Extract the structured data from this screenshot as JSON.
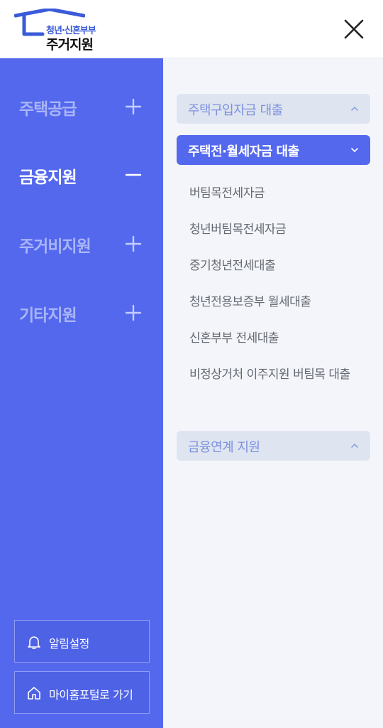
{
  "header": {
    "logo_line1": "청년·신혼부부",
    "logo_line2": "주거지원"
  },
  "sidebar": {
    "categories": [
      {
        "label": "주택공급",
        "state": "collapsed"
      },
      {
        "label": "금융지원",
        "state": "expanded"
      },
      {
        "label": "주거비지원",
        "state": "collapsed"
      },
      {
        "label": "기타지원",
        "state": "collapsed"
      }
    ],
    "buttons": [
      {
        "label": "알림설정"
      },
      {
        "label": "마이홈포털로 가기"
      }
    ]
  },
  "content": {
    "sections": [
      {
        "title": "주택구입자금 대출",
        "state": "collapsed"
      },
      {
        "title": "주택전·월세자금 대출",
        "state": "expanded"
      },
      {
        "title": "금융연계 지원",
        "state": "collapsed"
      }
    ],
    "subitems": [
      "버팀목전세자금",
      "청년버팀목전세자금",
      "중기청년전세대출",
      "청년전용보증부 월세대출",
      "신혼부부 전세대출",
      "비정상거처 이주지원 버팀목 대출"
    ]
  },
  "colors": {
    "sidebar_bg": "#5468ee",
    "content_bg": "#f3f5fa",
    "accent": "#5468ee",
    "inactive_text": "#a9b5f7"
  }
}
